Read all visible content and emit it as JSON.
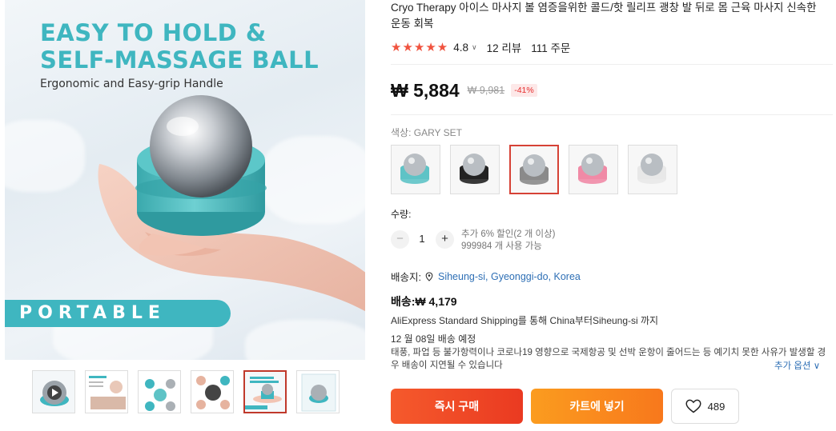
{
  "product": {
    "title": "Cryo Therapy 아이스 마사지 볼 염증을위한 콜드/핫 릴리프 괭창 발 뒤로 몸 근육 마사지 신속한 운동 회복",
    "rating": "4.8",
    "reviews": "12 리뷰",
    "orders": "111 주문",
    "stars": "★★★★★"
  },
  "gallery": {
    "headline_line1": "EASY TO HOLD &",
    "headline_line2": "SELF-MASSAGE BALL",
    "subline": "Ergonomic and Easy-grip Handle",
    "badge": "PORTABLE",
    "thumbnails": [
      "video",
      "guide",
      "parts",
      "steps",
      "easy-to-hold",
      "package"
    ],
    "active_thumbnail": 4
  },
  "pricing": {
    "price": "₩ 5,884",
    "original_price": "₩ 9,981",
    "discount": "-41%"
  },
  "variants": {
    "label": "색상:",
    "selected_name": "GARY SET",
    "options": [
      {
        "name": "teal",
        "cap": "#5ec3c6"
      },
      {
        "name": "black",
        "cap": "#222222"
      },
      {
        "name": "gray",
        "cap": "#8a8a8a"
      },
      {
        "name": "pink",
        "cap": "#f08aa6"
      },
      {
        "name": "white",
        "cap": "#eeeeee"
      }
    ],
    "selected_index": 2
  },
  "quantity": {
    "label": "수량:",
    "value": "1",
    "note_line1": "추가 6% 할인(2 개 이상)",
    "note_line2": "999984 개 사용 가능"
  },
  "shipping": {
    "to_label": "배송지:",
    "location": "Siheung-si, Gyeonggi-do, Korea",
    "cost": "배송:₩ 4,179",
    "via": "AliExpress Standard Shipping를 통해 China부터Siheung-si 까지",
    "date": "12 월 08일 배송 예정",
    "warning": "태풍, 파업 등 불가항력이나 코로나19 영향으로 국제항공 및 선박 운항이 줄어드는 등 예기치 못한 사유가 발생할 경우 배송이 지연될 수 있습니다",
    "more_options": "추가 옵션 ∨"
  },
  "actions": {
    "buy_now": "즉시 구매",
    "add_to_cart": "카트에 넣기",
    "wishlist_count": "489"
  },
  "colors": {
    "accent_teal": "#3fb6c0",
    "buy_red": "#ea3a21",
    "cart_orange": "#f8781c",
    "star": "#f0533f"
  }
}
